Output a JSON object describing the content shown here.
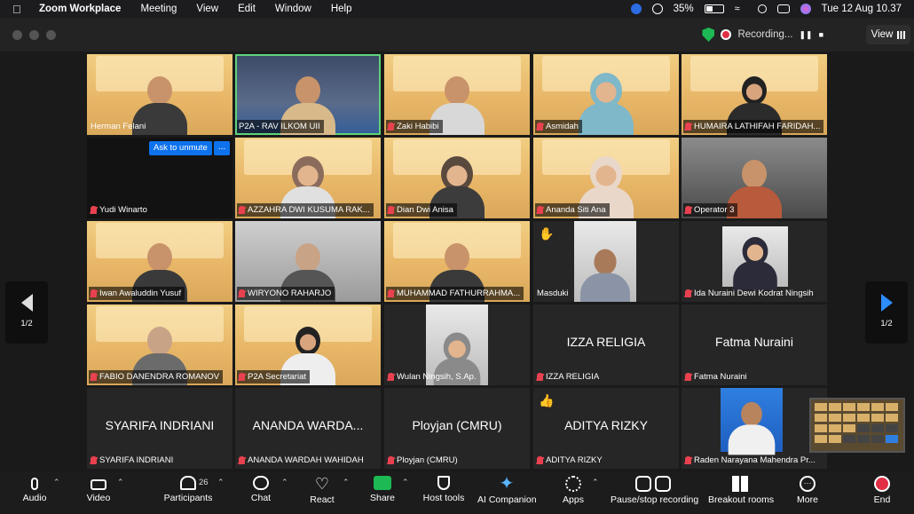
{
  "menubar": {
    "app_name": "Zoom Workplace",
    "menus": [
      "Meeting",
      "View",
      "Edit",
      "Window",
      "Help"
    ],
    "battery": "35%",
    "datetime": "Tue 12 Aug  10.37"
  },
  "titlebar": {
    "recording_label": "Recording...",
    "view_label": "View"
  },
  "pager": {
    "left": "1/2",
    "right": "1/2"
  },
  "tiles": {
    "herman": "Herman Felani",
    "p2a_rav": "P2A - RAV ILKOM UII",
    "zaki": "Zaki Habibi",
    "asmidah": "Asmidah",
    "humaira": "HUMAIRA LATHIFAH FARIDAH...",
    "yudi": "Yudi Winarto",
    "unmute": "Ask to unmute",
    "more": "...",
    "azzahra": "AZZAHRA DWI KUSUMA RAK...",
    "dian": "Dian Dwi Anisa",
    "ananda_siti": "Ananda Siti Ana",
    "operator": "Operator 3",
    "iwan": "Iwan Awaluddin Yusuf",
    "wiryono": "WIRYONO RAHARJO",
    "fathur": "MUHAMMAD FATHURRAHMA...",
    "masduki": "Masduki",
    "ida": "Ida Nuraini Dewi Kodrat Ningsih",
    "fabio": "FABIO DANENDRA ROMANOV",
    "p2a_sec": "P2A Secretariat",
    "wulan": "Wulan Ningsih, S.Ap.",
    "izza_big": "IZZA RELIGIA",
    "izza": "IZZA RELIGIA",
    "fatma_big": "Fatma Nuraini",
    "fatma": "Fatma Nuraini",
    "syarifa_big": "SYARIFA INDRIANI",
    "syarifa": "SYARIFA INDRIANI",
    "ananda_w_big": "ANANDA WARDA...",
    "ananda_w": "ANANDA WARDAH WAHIDAH",
    "ployjan_big": "Ployjan (CMRU)",
    "ployjan": "Ployjan (CMRU)",
    "aditya_big": "ADITYA RIZKY",
    "aditya": "ADITYA RIZKY",
    "raden": "Raden Narayana Mahendra Pr..."
  },
  "toolbar": {
    "audio": "Audio",
    "video": "Video",
    "participants": "Participants",
    "participants_count": "26",
    "chat": "Chat",
    "react": "React",
    "share": "Share",
    "host_tools": "Host tools",
    "ai_companion": "AI Companion",
    "apps": "Apps",
    "pause_stop": "Pause/stop recording",
    "breakout": "Breakout rooms",
    "more": "More",
    "end": "End"
  },
  "colors": {
    "accent_blue": "#0e72ed",
    "active_speaker": "#5fd27a",
    "mute_red": "#e8414f",
    "end_red": "#e02f44"
  }
}
